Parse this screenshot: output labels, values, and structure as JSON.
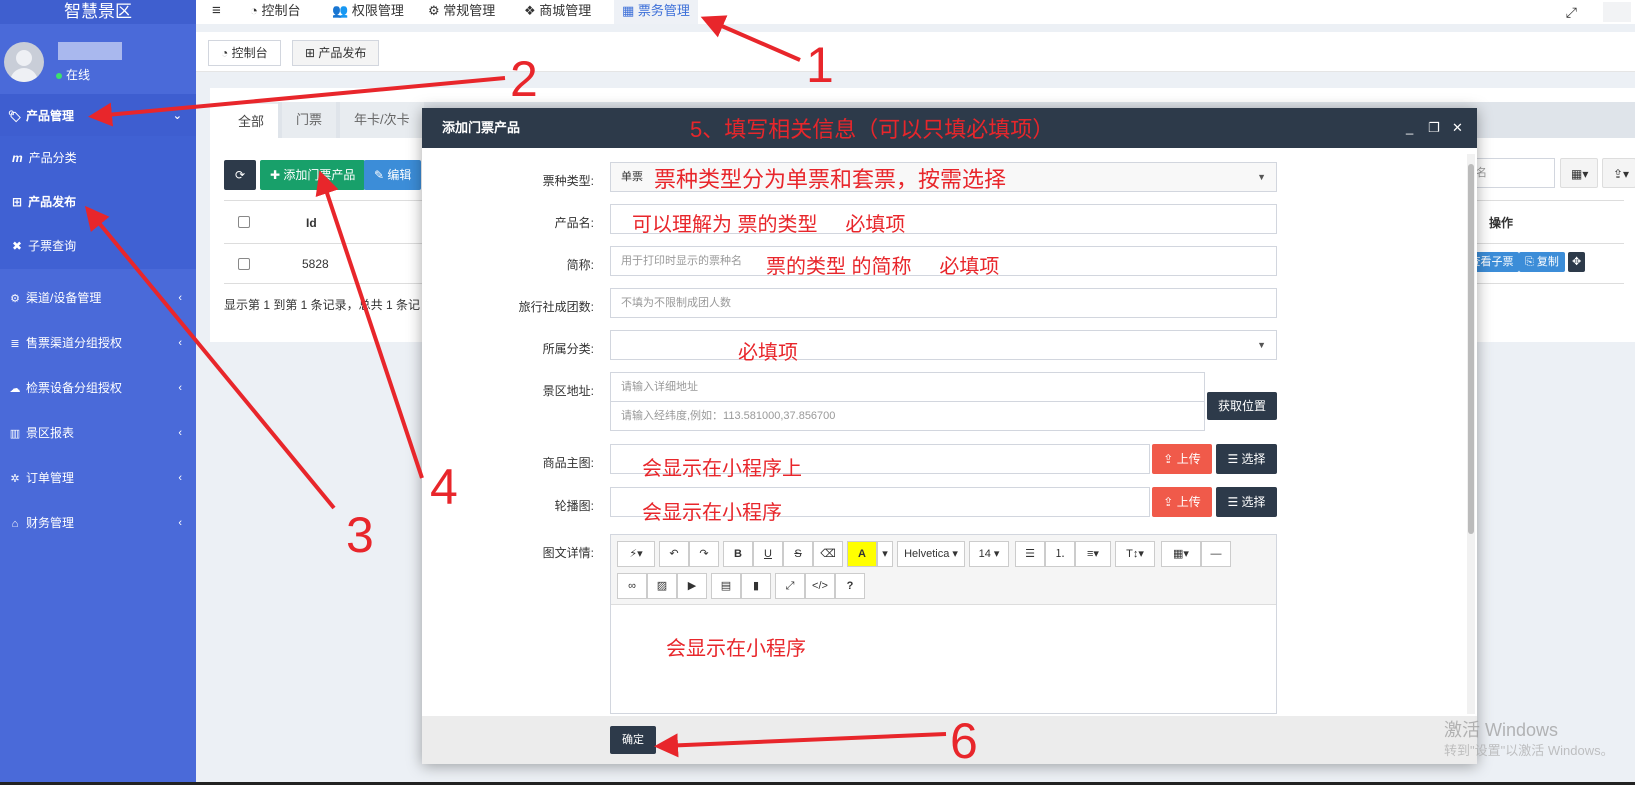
{
  "sidebar": {
    "brand": "智慧景区",
    "status": "在线",
    "menu": [
      {
        "label": "产品管理",
        "icon": "tag-icon",
        "glyph": "🏷",
        "expanded": true
      },
      {
        "label": "渠道/设备管理",
        "icon": "gears-icon",
        "glyph": "⚙"
      },
      {
        "label": "售票渠道分组授权",
        "icon": "database-icon",
        "glyph": "≣"
      },
      {
        "label": "检票设备分组授权",
        "icon": "cloud-icon",
        "glyph": "☁"
      },
      {
        "label": "景区报表",
        "icon": "bar-chart-icon",
        "glyph": "▥"
      },
      {
        "label": "订单管理",
        "icon": "gear-icon",
        "glyph": "✲"
      },
      {
        "label": "财务管理",
        "icon": "bank-icon",
        "glyph": "⌂"
      }
    ],
    "submenu": [
      {
        "label": "产品分类",
        "glyph": "m"
      },
      {
        "label": "产品发布",
        "glyph": "⊞"
      },
      {
        "label": "子票查询",
        "glyph": "✖"
      }
    ]
  },
  "topnav": {
    "items": [
      {
        "label": "控制台",
        "glyph": "◔"
      },
      {
        "label": "权限管理",
        "glyph": "👥"
      },
      {
        "label": "常规管理",
        "glyph": "⚙"
      },
      {
        "label": "商城管理",
        "glyph": "❖"
      },
      {
        "label": "票务管理",
        "glyph": "▦"
      }
    ],
    "menu_glyph": "≡",
    "fullscreen_glyph": "⤢"
  },
  "page_tabs": [
    {
      "label": "控制台",
      "glyph": "◔"
    },
    {
      "label": "产品发布",
      "glyph": "⊞"
    }
  ],
  "content": {
    "tabs": [
      "全部",
      "门票",
      "年卡/次卡"
    ],
    "toolbar": {
      "refresh": "⟳",
      "add": "✚ 添加门票产品",
      "edit": "✎ 编辑"
    },
    "table": {
      "col_id": "Id",
      "col_action": "操作",
      "row_id": "5828"
    },
    "row_actions": [
      "查看子票",
      "复制"
    ],
    "search_placeholder": "名",
    "pager": "显示第 1 到第 1 条记录，总共 1 条记"
  },
  "modal": {
    "title": "添加门票产品",
    "ctrl_min": "_",
    "ctrl_max": "❐",
    "ctrl_close": "✕",
    "fields": {
      "ticket_type_label": "票种类型:",
      "ticket_type_value": "单票",
      "product_name_label": "产品名:",
      "short_name_label": "简称:",
      "short_name_placeholder": "用于打印时显示的票种名",
      "group_label": "旅行社成团数:",
      "group_placeholder": "不填为不限制成团人数",
      "category_label": "所属分类:",
      "address_label": "景区地址:",
      "address_placeholder": "请输入详细地址",
      "coords_placeholder": "请输入经纬度,例如：113.581000,37.856700",
      "locate_button": "获取位置",
      "main_image_label": "商品主图:",
      "carousel_label": "轮播图:",
      "upload_button": "上传",
      "choose_button": "选择",
      "detail_label": "图文详情:"
    },
    "editor": {
      "font": "Helvetica",
      "size": "14"
    },
    "confirm_button": "确定"
  },
  "annotations": {
    "n1": "1",
    "n2": "2",
    "n3": "3",
    "n4": "4",
    "n5": "5、填写相关信息（可以只填必填项）",
    "n6": "6",
    "ticket_type": "票种类型分为单票和套票，按需选择",
    "product_name": "可以理解为 票的类型     必填项",
    "short_name": "票的类型 的简称     必填项",
    "category": "必填项",
    "main_image": "会显示在小程序上",
    "carousel": "会显示在小程序",
    "detail": "会显示在小程序",
    "color": "#e8262b"
  },
  "watermark": {
    "line1": "激活 Windows",
    "line2": "转到\"设置\"以激活 Windows。"
  }
}
